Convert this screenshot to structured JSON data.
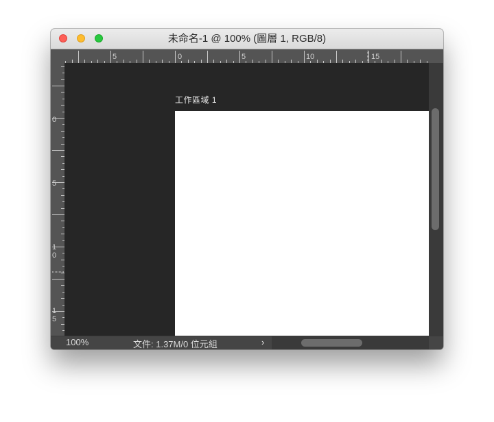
{
  "window": {
    "title": "未命名-1 @ 100% (圖層 1, RGB/8)"
  },
  "rulers": {
    "top_labels": [
      "5",
      "0",
      "5",
      "10",
      "15"
    ],
    "left_labels": [
      "0",
      "5",
      "1\n0",
      "1\n5"
    ]
  },
  "canvas": {
    "artboard_label": "工作區域 1"
  },
  "status": {
    "zoom": "100%",
    "doc_info": "文件: 1.37M/0 位元組",
    "arrow": "›"
  },
  "colors": {
    "pasteboard": "#262626",
    "ruler": "#545454",
    "artboard": "#ffffff"
  }
}
